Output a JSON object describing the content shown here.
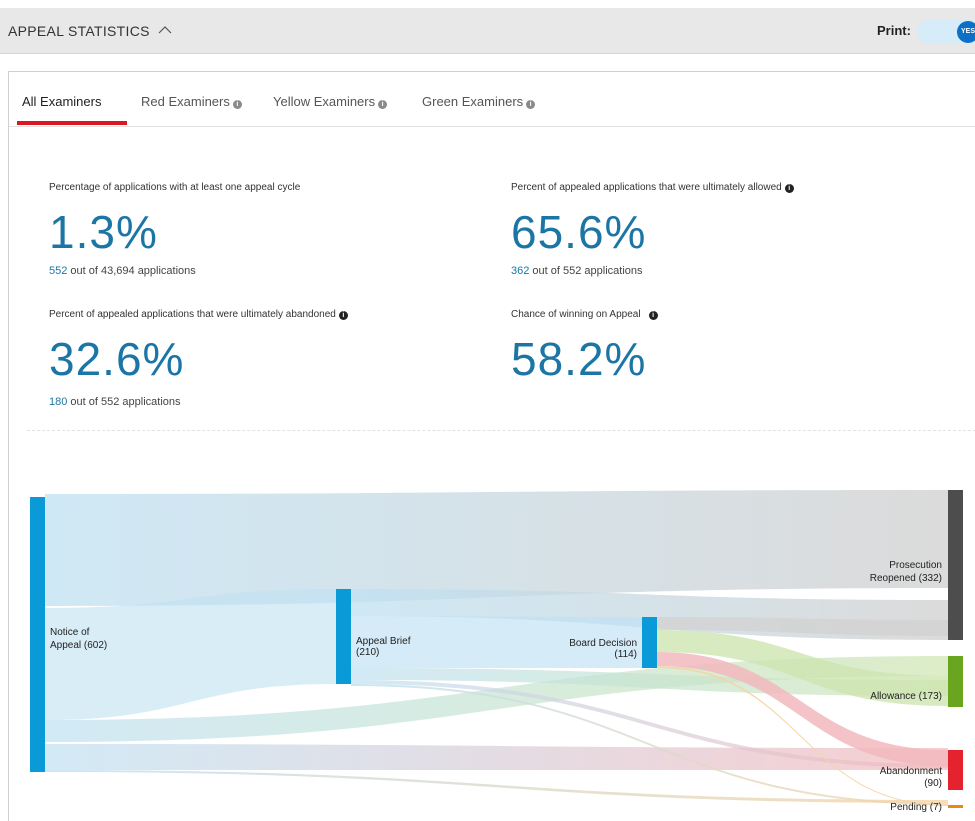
{
  "header": {
    "title": "APPEAL STATISTICS",
    "print_label": "Print:",
    "toggle_text": "YES"
  },
  "tabs": [
    {
      "label": "All Examiners",
      "active": true
    },
    {
      "label": "Red Examiners",
      "active": false
    },
    {
      "label": "Yellow Examiners",
      "active": false
    },
    {
      "label": "Green Examiners",
      "active": false
    }
  ],
  "stats": {
    "appeal_cycle": {
      "label": "Percentage of applications with at least one appeal cycle",
      "value": "1.3%",
      "sub_num": "552",
      "sub_text": " out of 43,694 applications"
    },
    "allowed": {
      "label": "Percent of appealed applications that were ultimately allowed",
      "value": "65.6%",
      "sub_num": "362",
      "sub_text": " out of 552 applications"
    },
    "abandoned": {
      "label": "Percent of appealed applications that were ultimately abandoned",
      "value": "32.6%",
      "sub_num": "180",
      "sub_text": " out of 552 applications"
    },
    "winning": {
      "label": "Chance of winning on Appeal",
      "value": "58.2%"
    }
  },
  "sankey": {
    "nodes": {
      "notice": {
        "line1": "Notice of",
        "line2": "Appeal (602)"
      },
      "brief": {
        "line1": "Appeal Brief",
        "line2": "(210)"
      },
      "board": {
        "line1": "Board Decision",
        "line2": "(114)"
      },
      "reopened": {
        "line1": "Prosecution",
        "line2": "Reopened (332)"
      },
      "allowance": {
        "line1": "Allowance (173)"
      },
      "abandonment": {
        "line1": "Abandonment",
        "line2": "(90)"
      },
      "pending": {
        "line1": "Pending (7)"
      }
    },
    "colors": {
      "notice": "#0a9ad8",
      "reopened": "#4d4d4d",
      "allowance": "#6aa51f",
      "abandonment": "#e4232f",
      "pending": "#e58a12"
    }
  }
}
